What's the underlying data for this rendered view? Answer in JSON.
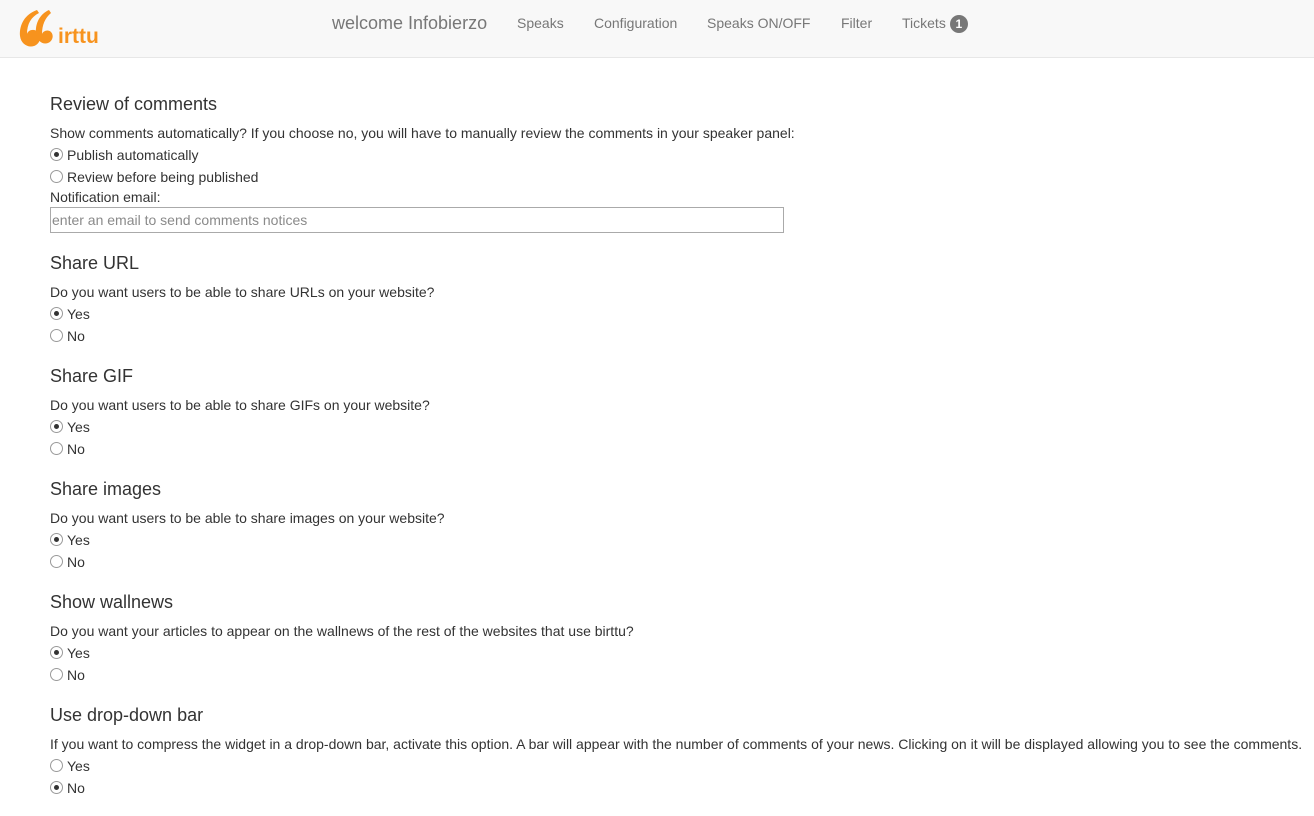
{
  "brand": {
    "logo_text": "irttu",
    "accent": "#f7931e"
  },
  "nav": {
    "welcome": "welcome Infobierzo",
    "items": [
      "Speaks",
      "Configuration",
      "Speaks ON/OFF",
      "Filter"
    ],
    "tickets_label": "Tickets",
    "tickets_count": "1"
  },
  "sections": {
    "review": {
      "title": "Review of comments",
      "question": "Show comments automatically? If you choose no, you will have to manually review the comments in your speaker panel:",
      "options": [
        "Publish automatically",
        "Review before being published"
      ],
      "selected": "Publish automatically",
      "email_label": "Notification email:",
      "email_placeholder": "enter an email to send comments notices",
      "email_value": ""
    },
    "share_url": {
      "title": "Share URL",
      "question": "Do you want users to be able to share URLs on your website?",
      "options": [
        "Yes",
        "No"
      ],
      "selected": "Yes"
    },
    "share_gif": {
      "title": "Share GIF",
      "question": "Do you want users to be able to share GIFs on your website?",
      "options": [
        "Yes",
        "No"
      ],
      "selected": "Yes"
    },
    "share_images": {
      "title": "Share images",
      "question": "Do you want users to be able to share images on your website?",
      "options": [
        "Yes",
        "No"
      ],
      "selected": "Yes"
    },
    "wallnews": {
      "title": "Show wallnews",
      "question": "Do you want your articles to appear on the wallnews of the rest of the websites that use birttu?",
      "options": [
        "Yes",
        "No"
      ],
      "selected": "Yes"
    },
    "dropdown_bar": {
      "title": "Use drop-down bar",
      "question": "If you want to compress the widget in a drop-down bar, activate this option. A bar will appear with the number of comments of your news. Clicking on it will be displayed allowing you to see the comments.",
      "options": [
        "Yes",
        "No"
      ],
      "selected": "No"
    }
  }
}
